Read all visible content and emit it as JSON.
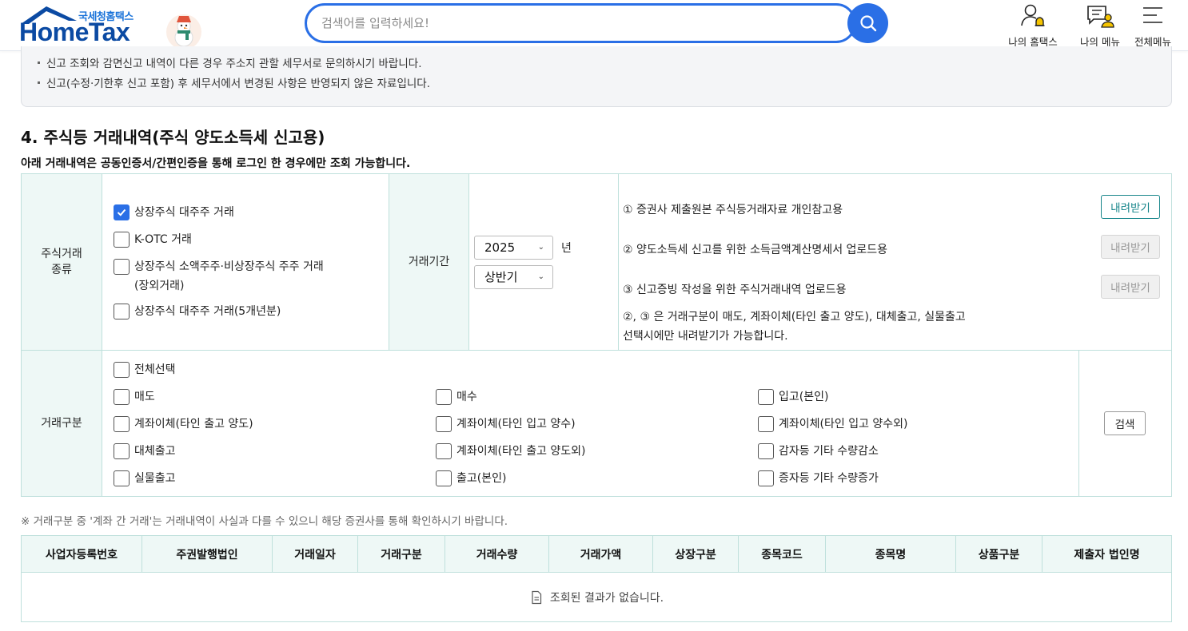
{
  "header": {
    "logo_sub": "국세청홈택스",
    "logo_main": "HomeTax",
    "search_placeholder": "검색어를 입력하세요!",
    "nav": [
      "나의 홈택스",
      "나의 메뉴",
      "전체메뉴"
    ]
  },
  "notices": [
    "신고 조회와 감면신고 내역이 다른 경우 주소지 관할 세무서로 문의하시기 바랍니다.",
    "신고(수정·기한후 신고 포함) 후 세무서에서 변경된 사항은 반영되지 않은 자료입니다."
  ],
  "section": {
    "title": "4. 주식등 거래내역(주식 양도소득세 신고용)",
    "desc": "아래 거래내역은 공동인증서/간편인증을 통해 로그인 한 경우에만 조회 가능합니다."
  },
  "filter": {
    "stock_type_label_1": "주식거래",
    "stock_type_label_2": "종류",
    "stock_types": [
      {
        "label": "상장주식 대주주 거래",
        "checked": true
      },
      {
        "label": "K-OTC 거래",
        "checked": false
      },
      {
        "label": "상장주식 소액주주·비상장주식 주주 거래",
        "label2": "(장외거래)",
        "checked": false
      },
      {
        "label": "상장주식 대주주 거래(5개년분)",
        "checked": false
      }
    ],
    "period_label": "거래기간",
    "year_value": "2025",
    "year_unit": "년",
    "half_value": "상반기",
    "downloads": [
      {
        "label": "① 증권사 제출원본 주식등거래자료 개인참고용",
        "button": "내려받기",
        "enabled": true
      },
      {
        "label": "② 양도소득세 신고를 위한 소득금액계산명세서 업로드용",
        "button": "내려받기",
        "enabled": false
      },
      {
        "label": "③ 신고증빙 작성을 위한 주식거래내역 업로드용",
        "button": "내려받기",
        "enabled": false
      }
    ],
    "download_note_1": "②, ③ 은 거래구분이 매도, 계좌이체(타인 출고 양도), 대체출고, 실물출고",
    "download_note_2": "선택시에만 내려받기가 가능합니다.",
    "trade_type_label": "거래구분",
    "select_all": "전체선택",
    "trade_types": [
      [
        "매도",
        "매수",
        "입고(본인)"
      ],
      [
        "계좌이체(타인 출고 양도)",
        "계좌이체(타인 입고 양수)",
        "계좌이체(타인 입고 양수외)"
      ],
      [
        "대체출고",
        "계좌이체(타인 출고 양도외)",
        "감자등 기타 수량감소"
      ],
      [
        "실물출고",
        "출고(본인)",
        "증자등 기타 수량증가"
      ]
    ],
    "search_button": "검색"
  },
  "note": "※ 거래구분 중 '계좌 간 거래'는 거래내역이 사실과 다를 수 있으니 해당 증권사를 통해 확인하시기 바랍니다.",
  "results": {
    "columns": [
      "사업자등록번호",
      "주권발행법인",
      "거래일자",
      "거래구분",
      "거래수량",
      "거래가액",
      "상장구분",
      "종목코드",
      "종목명",
      "상품구분",
      "제출자 법인명"
    ],
    "empty_message": "조회된 결과가 없습니다."
  },
  "colors": {
    "accent": "#2a6fe6",
    "teal": "#18868b",
    "header_bg": "#eef8f6",
    "border": "#bfe0dc"
  }
}
